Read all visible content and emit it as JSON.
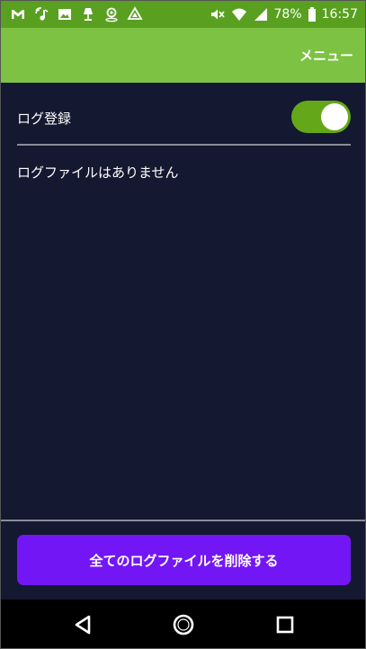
{
  "status_bar": {
    "battery": "78%",
    "time": "16:57",
    "left_icons": [
      "gmail-icon",
      "nfc-music-icon",
      "image-icon",
      "lamp-icon",
      "location-icon",
      "drive-icon"
    ],
    "right_icons": [
      "mute-icon",
      "wifi-icon",
      "signal-icon",
      "battery-icon"
    ]
  },
  "app_bar": {
    "menu_label": "メニュー",
    "color": "#7dc243"
  },
  "main": {
    "log_toggle_label": "ログ登録",
    "log_toggle_on": true,
    "empty_message": "ログファイルはありません"
  },
  "footer": {
    "delete_button_label": "全てのログファイルを削除する",
    "button_color": "#7316f5"
  },
  "nav_bar": {
    "icons": [
      "back-icon",
      "home-icon",
      "recent-apps-icon"
    ]
  }
}
